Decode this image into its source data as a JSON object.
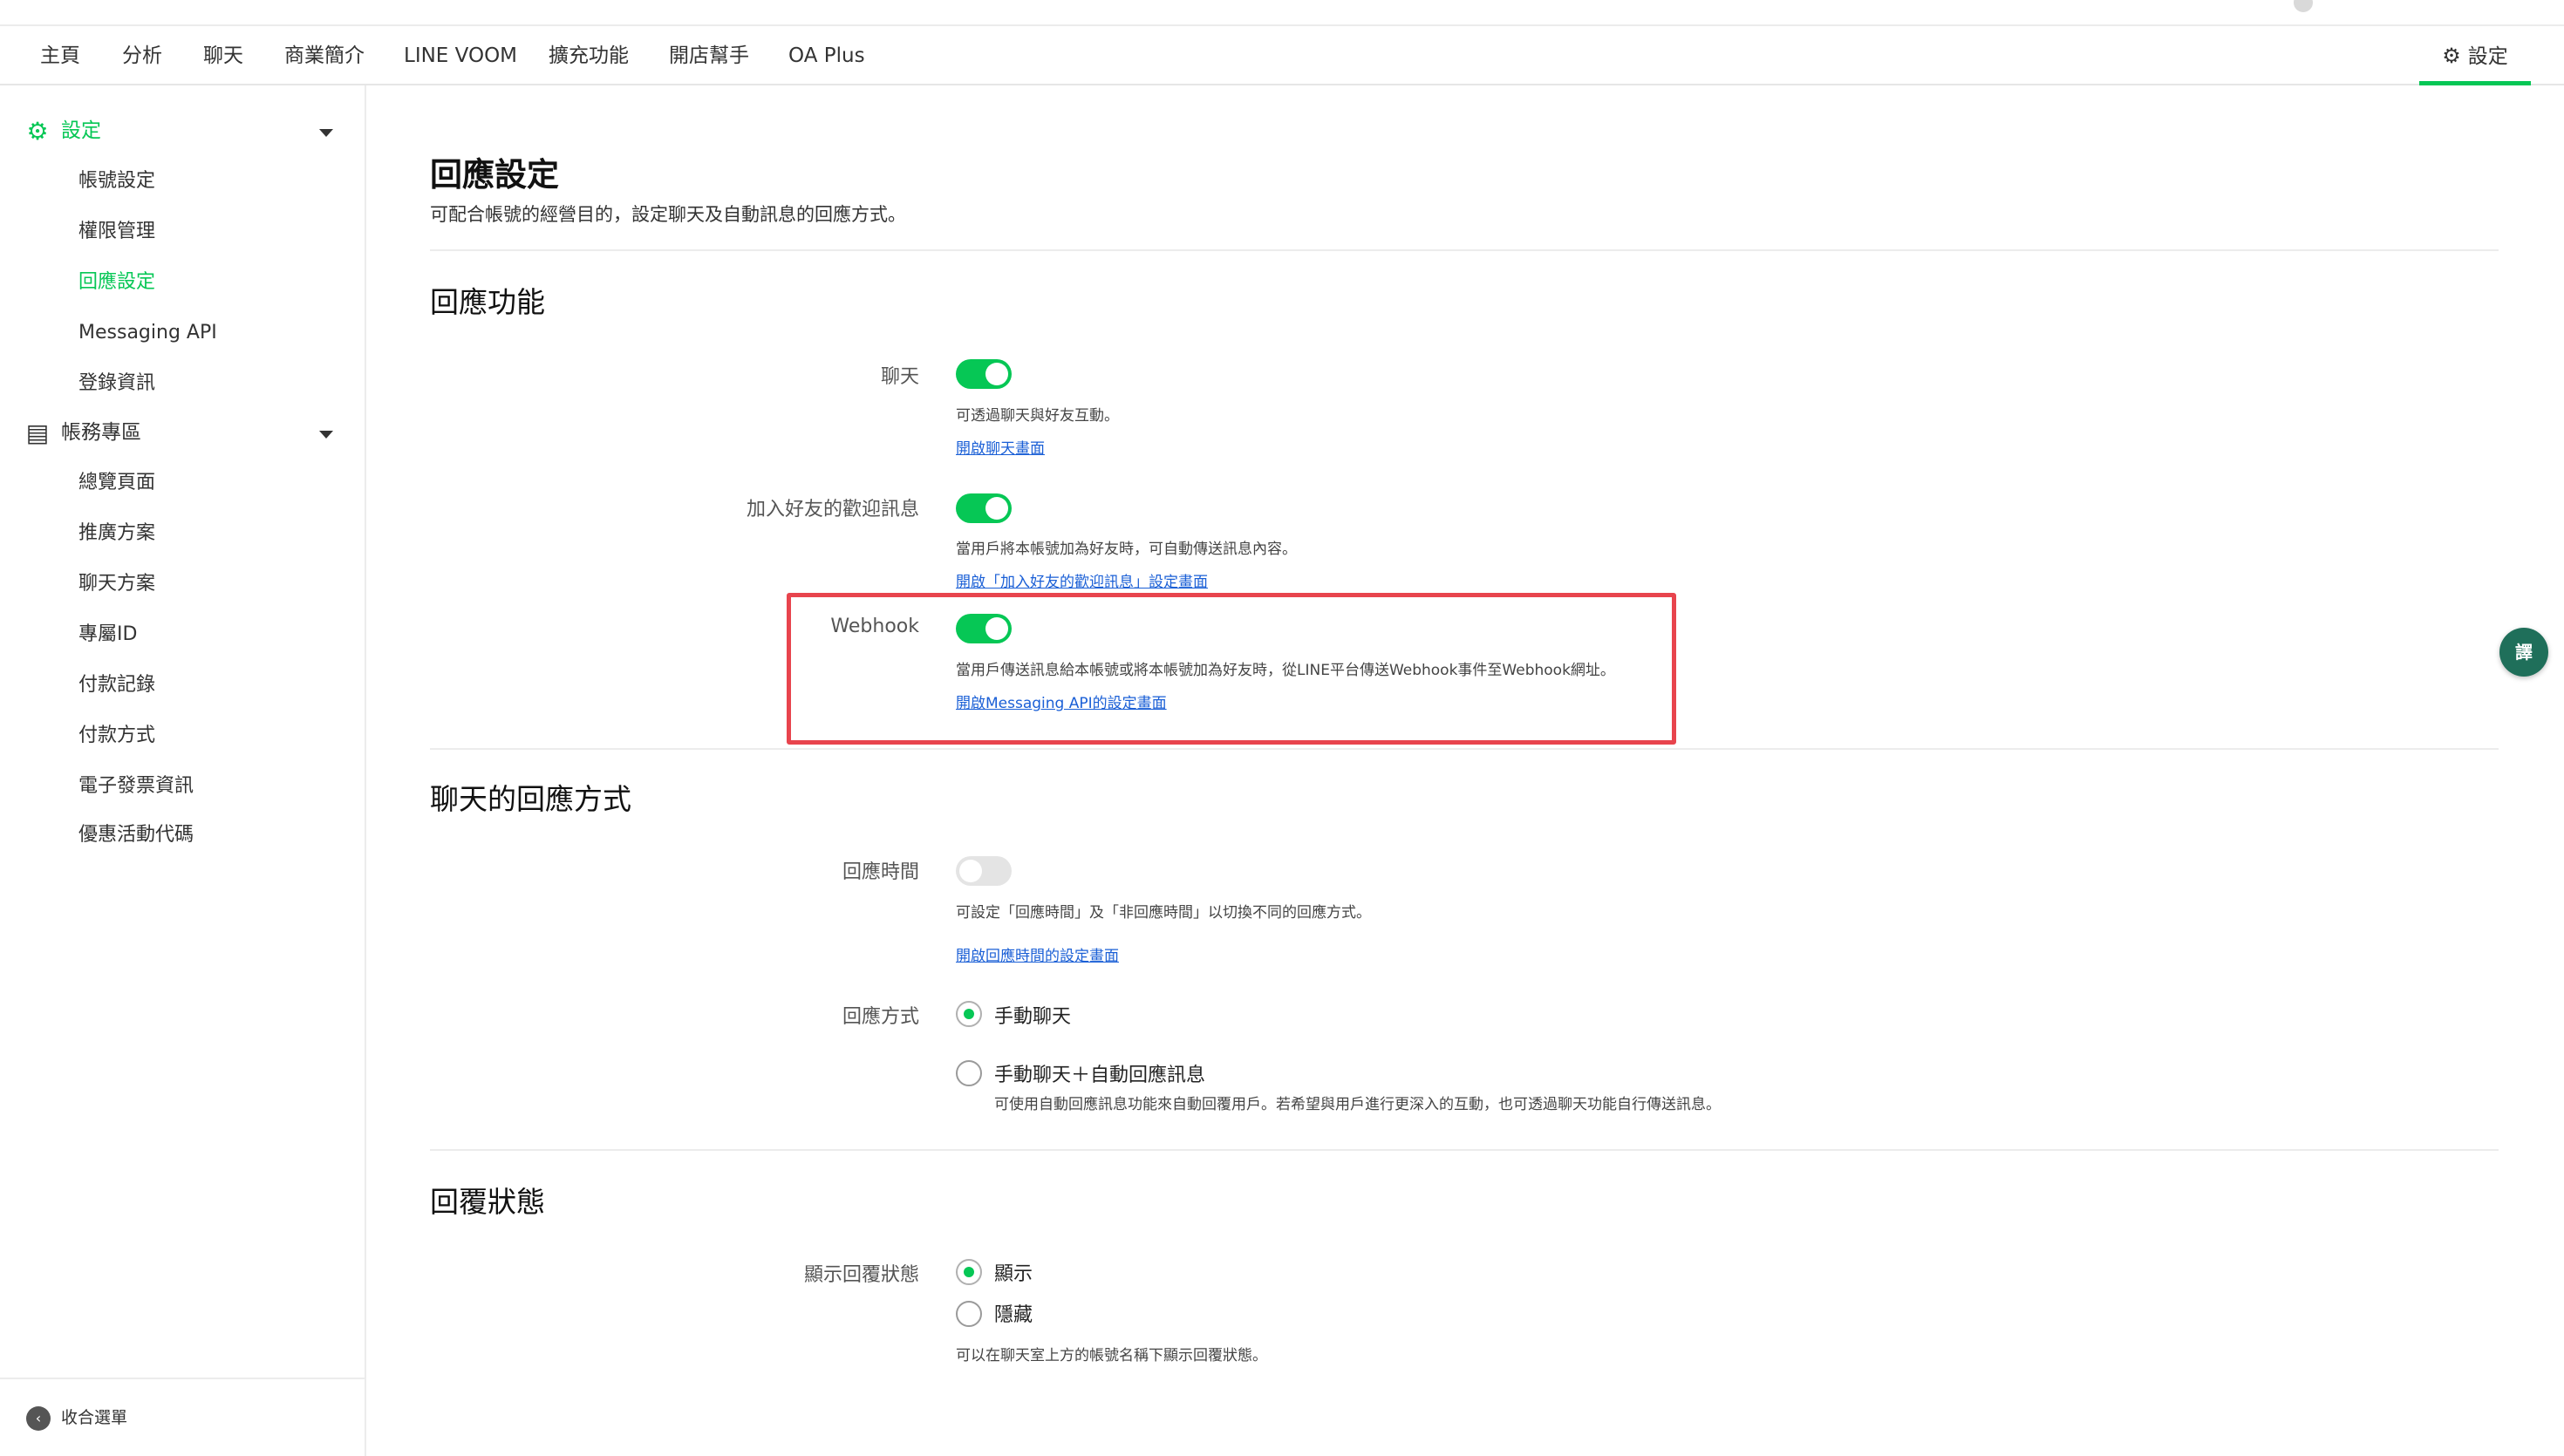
{
  "nav": {
    "items": [
      "主頁",
      "分析",
      "聊天",
      "商業簡介",
      "LINE VOOM",
      "擴充功能",
      "開店幫手",
      "OA Plus"
    ],
    "settings_label": "設定"
  },
  "sidebar": {
    "settings_group": "設定",
    "settings_items": [
      "帳號設定",
      "權限管理",
      "回應設定",
      "Messaging API",
      "登錄資訊"
    ],
    "account_group": "帳務專區",
    "account_items": [
      "總覽頁面",
      "推廣方案",
      "聊天方案",
      "專屬ID",
      "付款記錄",
      "付款方式",
      "電子發票資訊",
      "優惠活動代碼"
    ],
    "collapse_label": "收合選單"
  },
  "main": {
    "title": "回應設定",
    "description": "可配合帳號的經營目的，設定聊天及自動訊息的回應方式。",
    "response_features": {
      "heading": "回應功能",
      "chat": {
        "label": "聊天",
        "enabled": true,
        "desc": "可透過聊天與好友互動。",
        "link": "開啟聊天畫面"
      },
      "welcome": {
        "label": "加入好友的歡迎訊息",
        "enabled": true,
        "desc": "當用戶將本帳號加為好友時，可自動傳送訊息內容。",
        "link": "開啟「加入好友的歡迎訊息」設定畫面"
      },
      "webhook": {
        "label": "Webhook",
        "enabled": true,
        "desc": "當用戶傳送訊息給本帳號或將本帳號加為好友時，從LINE平台傳送Webhook事件至Webhook網址。",
        "link": "開啟Messaging API的設定畫面"
      }
    },
    "chat_response": {
      "heading": "聊天的回應方式",
      "response_time": {
        "label": "回應時間",
        "enabled": false,
        "desc": "可設定「回應時間」及「非回應時間」以切換不同的回應方式。",
        "link": "開啟回應時間的設定畫面"
      },
      "response_mode": {
        "label": "回應方式",
        "options": [
          "手動聊天",
          "手動聊天＋自動回應訊息"
        ],
        "selected": "手動聊天",
        "option2_desc": "可使用自動回應訊息功能來自動回覆用戶。若希望與用戶進行更深入的互動，也可透過聊天功能自行傳送訊息。"
      }
    },
    "reply_status": {
      "heading": "回覆狀態",
      "label": "顯示回覆狀態",
      "options": [
        "顯示",
        "隱藏"
      ],
      "selected": "顯示",
      "desc": "可以在聊天室上方的帳號名稱下顯示回覆狀態。"
    }
  },
  "floating": {
    "translate_label": "譯"
  },
  "colors": {
    "brand_green": "#06c755",
    "highlight_red": "#e8444d",
    "link_blue": "#1a5fd6"
  }
}
